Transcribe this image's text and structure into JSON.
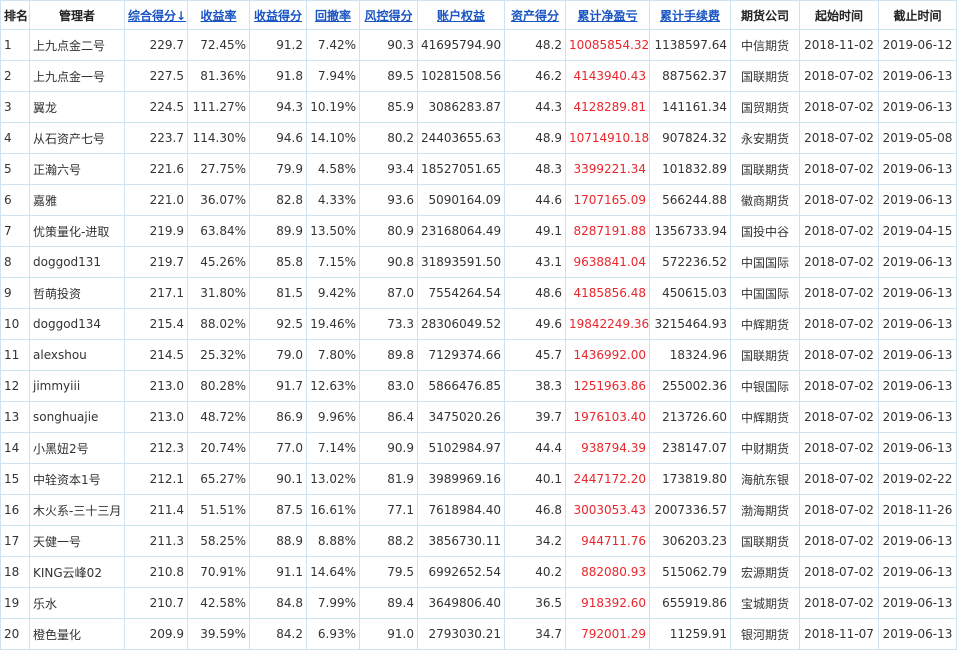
{
  "headers": [
    {
      "label": "排名",
      "sortable": false
    },
    {
      "label": "管理者",
      "sortable": false
    },
    {
      "label": "综合得分↓",
      "sortable": true
    },
    {
      "label": "收益率",
      "sortable": true
    },
    {
      "label": "收益得分",
      "sortable": true
    },
    {
      "label": "回撤率",
      "sortable": true
    },
    {
      "label": "风控得分",
      "sortable": true
    },
    {
      "label": "账户权益",
      "sortable": true
    },
    {
      "label": "资产得分",
      "sortable": true
    },
    {
      "label": "累计净盈亏",
      "sortable": true
    },
    {
      "label": "累计手续费",
      "sortable": true
    },
    {
      "label": "期货公司",
      "sortable": false
    },
    {
      "label": "起始时间",
      "sortable": false
    },
    {
      "label": "截止时间",
      "sortable": false
    }
  ],
  "rows": [
    [
      "1",
      "上九点金二号",
      "229.7",
      "72.45%",
      "91.2",
      "7.42%",
      "90.3",
      "41695794.90",
      "48.2",
      "10085854.32",
      "1138597.64",
      "中信期货",
      "2018-11-02",
      "2019-06-12"
    ],
    [
      "2",
      "上九点金一号",
      "227.5",
      "81.36%",
      "91.8",
      "7.94%",
      "89.5",
      "10281508.56",
      "46.2",
      "4143940.43",
      "887562.37",
      "国联期货",
      "2018-07-02",
      "2019-06-13"
    ],
    [
      "3",
      "翼龙",
      "224.5",
      "111.27%",
      "94.3",
      "10.19%",
      "85.9",
      "3086283.87",
      "44.3",
      "4128289.81",
      "141161.34",
      "国贸期货",
      "2018-07-02",
      "2019-06-13"
    ],
    [
      "4",
      "从石资产七号",
      "223.7",
      "114.30%",
      "94.6",
      "14.10%",
      "80.2",
      "24403655.63",
      "48.9",
      "10714910.18",
      "907824.32",
      "永安期货",
      "2018-07-02",
      "2019-05-08"
    ],
    [
      "5",
      "正瀚六号",
      "221.6",
      "27.75%",
      "79.9",
      "4.58%",
      "93.4",
      "18527051.65",
      "48.3",
      "3399221.34",
      "101832.89",
      "国联期货",
      "2018-07-02",
      "2019-06-13"
    ],
    [
      "6",
      "嘉雅",
      "221.0",
      "36.07%",
      "82.8",
      "4.33%",
      "93.6",
      "5090164.09",
      "44.6",
      "1707165.09",
      "566244.88",
      "徽商期货",
      "2018-07-02",
      "2019-06-13"
    ],
    [
      "7",
      "优策量化-进取",
      "219.9",
      "63.84%",
      "89.9",
      "13.50%",
      "80.9",
      "23168064.49",
      "49.1",
      "8287191.88",
      "1356733.94",
      "国投中谷",
      "2018-07-02",
      "2019-04-15"
    ],
    [
      "8",
      "doggod131",
      "219.7",
      "45.26%",
      "85.8",
      "7.15%",
      "90.8",
      "31893591.50",
      "43.1",
      "9638841.04",
      "572236.52",
      "中国国际",
      "2018-07-02",
      "2019-06-13"
    ],
    [
      "9",
      "哲萌投资",
      "217.1",
      "31.80%",
      "81.5",
      "9.42%",
      "87.0",
      "7554264.54",
      "48.6",
      "4185856.48",
      "450615.03",
      "中国国际",
      "2018-07-02",
      "2019-06-13"
    ],
    [
      "10",
      "doggod134",
      "215.4",
      "88.02%",
      "92.5",
      "19.46%",
      "73.3",
      "28306049.52",
      "49.6",
      "19842249.36",
      "3215464.93",
      "中辉期货",
      "2018-07-02",
      "2019-06-13"
    ],
    [
      "11",
      "alexshou",
      "214.5",
      "25.32%",
      "79.0",
      "7.80%",
      "89.8",
      "7129374.66",
      "45.7",
      "1436992.00",
      "18324.96",
      "国联期货",
      "2018-07-02",
      "2019-06-13"
    ],
    [
      "12",
      "jimmyiii",
      "213.0",
      "80.28%",
      "91.7",
      "12.63%",
      "83.0",
      "5866476.85",
      "38.3",
      "1251963.86",
      "255002.36",
      "中银国际",
      "2018-07-02",
      "2019-06-13"
    ],
    [
      "13",
      "songhuajie",
      "213.0",
      "48.72%",
      "86.9",
      "9.96%",
      "86.4",
      "3475020.26",
      "39.7",
      "1976103.40",
      "213726.60",
      "中辉期货",
      "2018-07-02",
      "2019-06-13"
    ],
    [
      "14",
      "小黑妞2号",
      "212.3",
      "20.74%",
      "77.0",
      "7.14%",
      "90.9",
      "5102984.97",
      "44.4",
      "938794.39",
      "238147.07",
      "中财期货",
      "2018-07-02",
      "2019-06-13"
    ],
    [
      "15",
      "中辁资本1号",
      "212.1",
      "65.27%",
      "90.1",
      "13.02%",
      "81.9",
      "3989969.16",
      "40.1",
      "2447172.20",
      "173819.80",
      "海航东银",
      "2018-07-02",
      "2019-02-22"
    ],
    [
      "16",
      "木火系-三十三月",
      "211.4",
      "51.51%",
      "87.5",
      "16.61%",
      "77.1",
      "7618984.40",
      "46.8",
      "3003053.43",
      "2007336.57",
      "渤海期货",
      "2018-07-02",
      "2018-11-26"
    ],
    [
      "17",
      "天健一号",
      "211.3",
      "58.25%",
      "88.9",
      "8.88%",
      "88.2",
      "3856730.11",
      "34.2",
      "944711.76",
      "306203.23",
      "国联期货",
      "2018-07-02",
      "2019-06-13"
    ],
    [
      "18",
      "KING云峰02",
      "210.8",
      "70.91%",
      "91.1",
      "14.64%",
      "79.5",
      "6992652.54",
      "40.2",
      "882080.93",
      "515062.79",
      "宏源期货",
      "2018-07-02",
      "2019-06-13"
    ],
    [
      "19",
      "乐水",
      "210.7",
      "42.58%",
      "84.8",
      "7.99%",
      "89.4",
      "3649806.40",
      "36.5",
      "918392.60",
      "655919.86",
      "宝城期货",
      "2018-07-02",
      "2019-06-13"
    ],
    [
      "20",
      "橙色量化",
      "209.9",
      "39.59%",
      "84.2",
      "6.93%",
      "91.0",
      "2793030.21",
      "34.7",
      "792001.29",
      "11259.91",
      "银河期货",
      "2018-11-07",
      "2019-06-13"
    ]
  ],
  "colors": {
    "link": "#1a55c4",
    "profit": "#e8262c",
    "border": "#cde3f0"
  }
}
